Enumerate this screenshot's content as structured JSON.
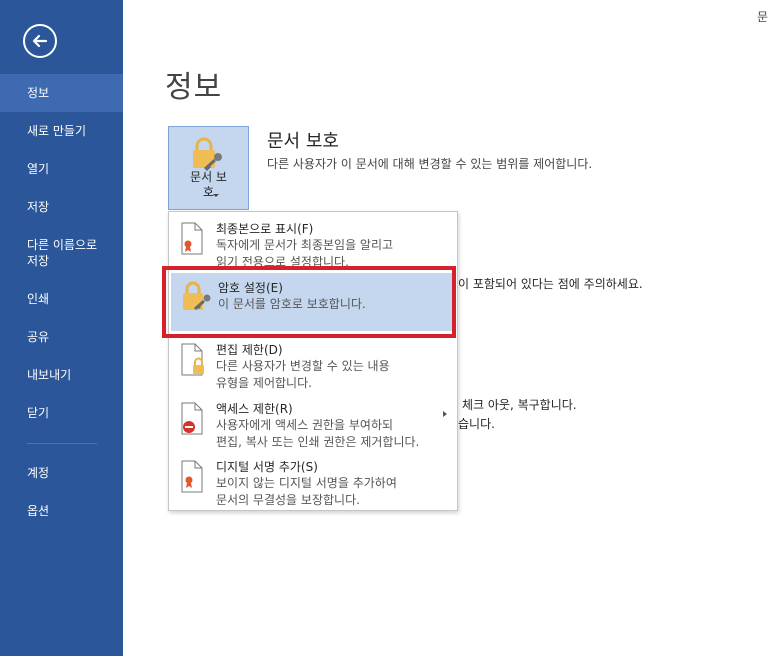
{
  "sidebar": {
    "items": [
      {
        "label": "정보",
        "selected": true
      },
      {
        "label": "새로 만들기"
      },
      {
        "label": "열기"
      },
      {
        "label": "저장"
      },
      {
        "label": "다른 이름으로\n저장"
      },
      {
        "label": "인쇄"
      },
      {
        "label": "공유"
      },
      {
        "label": "내보내기"
      },
      {
        "label": "닫기"
      },
      {
        "label": "계정"
      },
      {
        "label": "옵션"
      }
    ],
    "back_icon": "arrow-left-circle-icon",
    "bg_color": "#2b579a",
    "selected_color": "#3d6ab0"
  },
  "page": {
    "title": "정보",
    "corner_text": "문"
  },
  "protect": {
    "button_label": "문서 보\n호",
    "title": "문서 보호",
    "desc": "다른 사용자가 이 문서에 대해 변경할 수 있는 범위를 제어합니다."
  },
  "background_text": {
    "inspect_tail": "이 포함되어 있다는 점에 주의하세요.",
    "versions_tail": "체크 아웃, 복구합니다.",
    "versions_tail2": "습니다."
  },
  "menu": {
    "items": [
      {
        "title": "최종본으로 표시(F)",
        "desc": "독자에게 문서가 최종본임을 알리고\n읽기 전용으로 설정합니다.",
        "icon": "mark-final-icon"
      },
      {
        "title": "암호 설정(E)",
        "desc": "이 문서를 암호로 보호합니다.",
        "icon": "lock-key-icon",
        "highlighted": true
      },
      {
        "title": "편집 제한(D)",
        "desc": "다른 사용자가 변경할 수 있는 내용\n유형을 제어합니다.",
        "icon": "restrict-editing-icon"
      },
      {
        "title": "액세스 제한(R)",
        "desc": "사용자에게 액세스 권한을 부여하되\n편집, 복사 또는 인쇄 권한은 제거합니다.",
        "icon": "restrict-access-icon",
        "has_submenu": true
      },
      {
        "title": "디지털 서명 추가(S)",
        "desc": "보이지 않는 디지털 서명을 추가하여\n문서의 무결성을 보장합니다.",
        "icon": "digital-signature-icon"
      }
    ],
    "highlight_color": "#c5d7ef"
  },
  "annotation": {
    "color": "#d6202b"
  }
}
